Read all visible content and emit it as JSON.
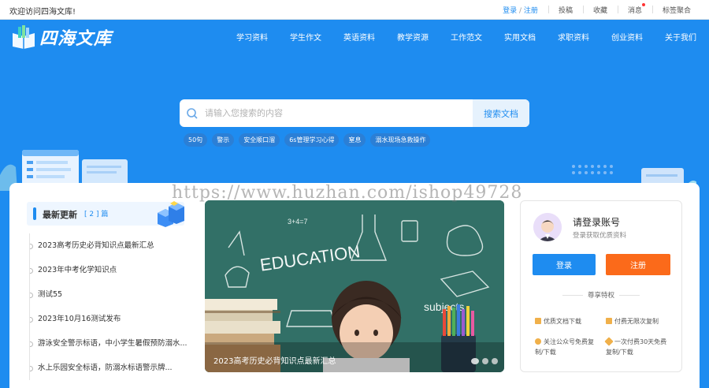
{
  "topbar": {
    "welcome": "欢迎访问四海文库!",
    "login": "登录",
    "sep": "/",
    "register": "注册",
    "links": [
      "投稿",
      "收藏",
      "消息",
      "标签聚合"
    ]
  },
  "logo": {
    "text": "四海文库"
  },
  "nav": [
    "学习资料",
    "学生作文",
    "英语资料",
    "教学资源",
    "工作范文",
    "实用文档",
    "求职资料",
    "创业资料",
    "关于我们"
  ],
  "search": {
    "placeholder": "请输入您搜索的内容",
    "button": "搜索文档",
    "tags": [
      "50句",
      "警示",
      "安全顺口溜",
      "6s管理学习心得",
      "窒息",
      "溺水现场急救操作"
    ]
  },
  "watermark": "https://www.huzhan.com/ishop49728",
  "latest": {
    "title": "最新更新",
    "count": "[ 2 ] 篇",
    "items": [
      "2023高考历史必背知识点最新汇总",
      "2023年中考化学知识点",
      "测试55",
      "2023年10月16测试发布",
      "游泳安全警示标语，中小学生暑假预防溺水...",
      "水上乐园安全标语，防溺水标语警示牌..."
    ]
  },
  "banner": {
    "caption": "2023高考历史必背知识点最新汇总",
    "board_text": "EDUCATION",
    "board_text2": "subjects",
    "board_formula": "3+4=7"
  },
  "login_box": {
    "title": "请登录账号",
    "subtitle": "登录获取优质资料",
    "login_btn": "登录",
    "register_btn": "注册",
    "privilege_title": "尊享特权",
    "privileges": [
      "优质文档下载",
      "付费无限次复制",
      "关注公众号免费复制/下载",
      "一次付费30天免费复制/下载"
    ]
  },
  "colors": {
    "primary": "#1e8cf0",
    "orange": "#fb6a1a",
    "board": "#2e6b63"
  }
}
